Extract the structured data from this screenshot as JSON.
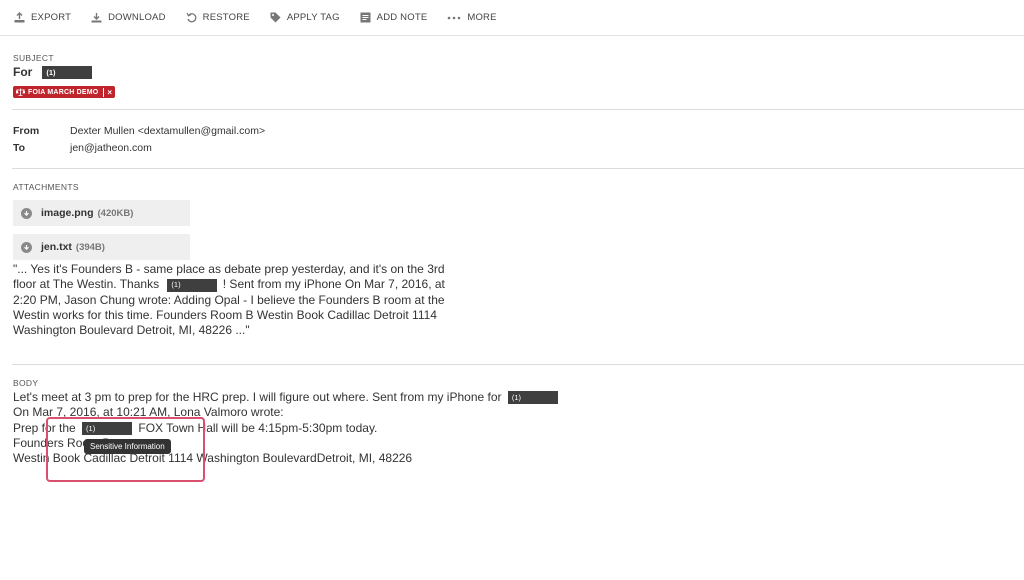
{
  "toolbar": {
    "export": "EXPORT",
    "download": "DOWNLOAD",
    "restore": "RESTORE",
    "apply_tag": "APPLY TAG",
    "add_note": "ADD NOTE",
    "more": "MORE"
  },
  "subject": {
    "label": "SUBJECT",
    "prefix": "For",
    "redaction": "(1)"
  },
  "tag": {
    "label": "FOIA MARCH DEMO",
    "remove": "×",
    "color": "#c0242c"
  },
  "headers": {
    "from_label": "From",
    "from_value": "Dexter Mullen <dextamullen@gmail.com>",
    "to_label": "To",
    "to_value": "jen@jatheon.com"
  },
  "attachments": {
    "label": "ATTACHMENTS",
    "items": [
      {
        "name": "image.png",
        "size": "(420KB)"
      },
      {
        "name": "jen.txt",
        "size": "(394B)"
      }
    ]
  },
  "snippet": {
    "line1": "\"... Yes it's Founders B - same place as debate prep yesterday, and it's on the 3rd",
    "line2a": "floor at The Westin. Thanks",
    "redaction": "(1)",
    "line2b": "! Sent from my iPhone On Mar 7, 2016, at",
    "line3": "2:20 PM, Jason Chung wrote: Adding Opal - I believe the Founders B room at the",
    "line4": "Westin works for this time. Founders Room B Westin Book Cadillac Detroit 1114",
    "line5": "Washington Boulevard Detroit, MI, 48226 ...\""
  },
  "body": {
    "label": "BODY",
    "line1": "Let's meet at 3 pm to prep for the HRC prep. I will figure out where. Sent from my iPhone for",
    "line1_redaction": "(1)",
    "line2": "On Mar 7, 2016, at 10:21 AM, Lona Valmoro wrote:",
    "line3a": "Prep for the",
    "line3_redaction": "(1)",
    "line3b": "FOX Town Hall will be 4:15pm-5:30pm today.",
    "line4": "Founders Room B",
    "line5": "Westin Book Cadillac Detroit 1114 Washington BoulevardDetroit, MI, 48226"
  },
  "tooltip": {
    "text": "Sensitive Information"
  },
  "colors": {
    "highlight": "#d94f6d",
    "redaction": "#3f3f3f"
  }
}
